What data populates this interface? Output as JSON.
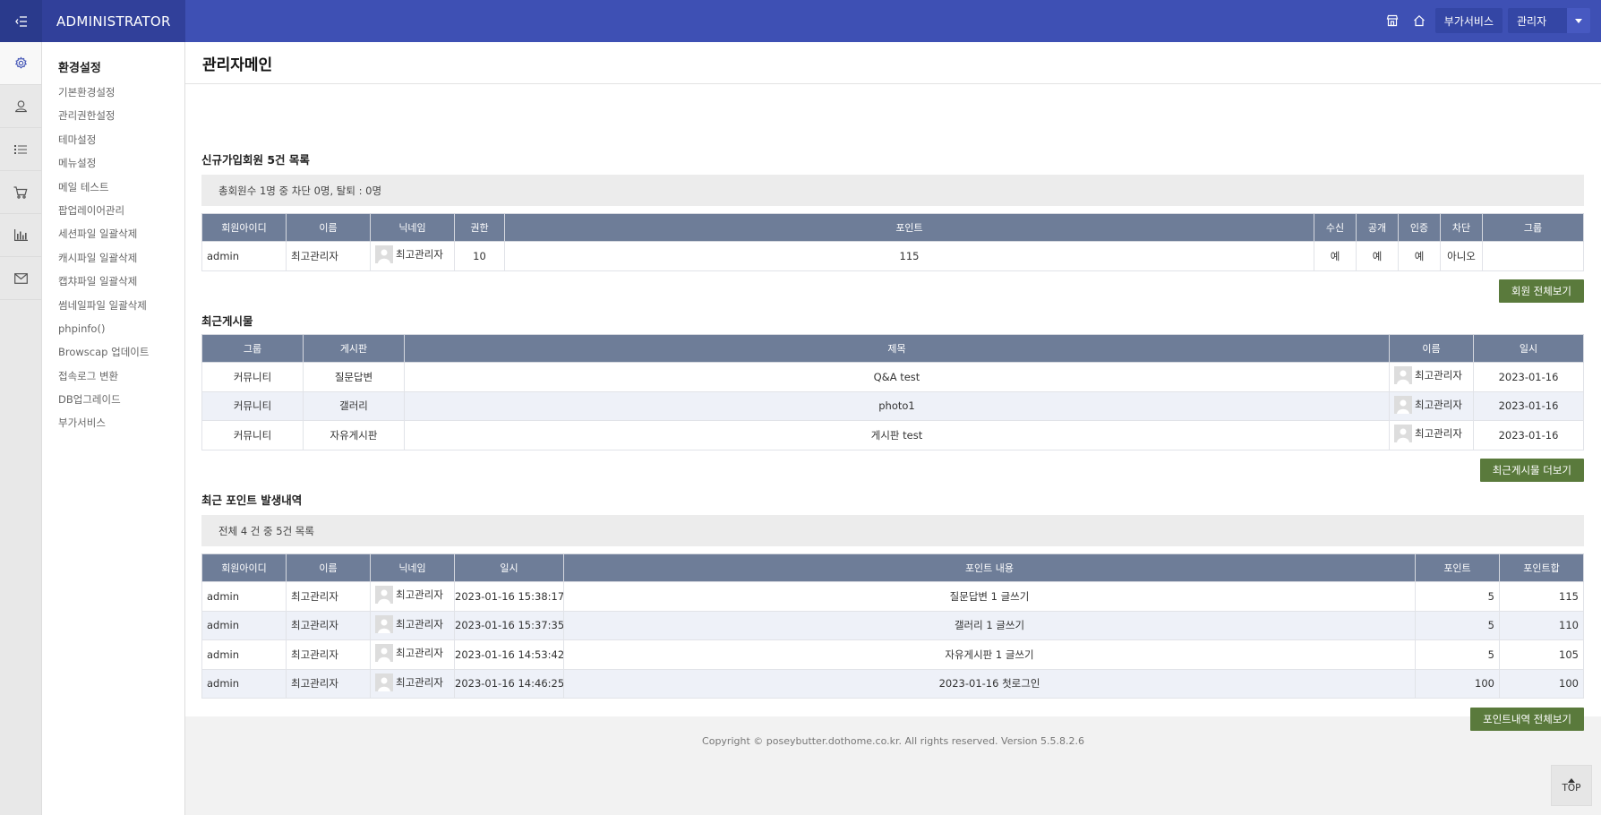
{
  "header": {
    "logo": "ADMINISTRATOR",
    "service_label": "부가서비스",
    "admin_label": "관리자",
    "brand_color": "#3e50b4"
  },
  "rail_icons": [
    "gear-icon",
    "user-icon",
    "list-icon",
    "cart-icon",
    "chart-icon",
    "mail-icon"
  ],
  "submenu": {
    "title": "환경설정",
    "items": [
      "기본환경설정",
      "관리권한설정",
      "테마설정",
      "메뉴설정",
      "메일 테스트",
      "팝업레이어관리",
      "세션파일 일괄삭제",
      "캐시파일 일괄삭제",
      "캡챠파일 일괄삭제",
      "썸네일파일 일괄삭제",
      "phpinfo()",
      "Browscap 업데이트",
      "접속로그 변환",
      "DB업그레이드",
      "부가서비스"
    ]
  },
  "page_title": "관리자메인",
  "new_members": {
    "title": "신규가입회원 5건 목록",
    "summary": "총회원수 1명 중 차단 0명, 탈퇴 : 0명",
    "columns": [
      "회원아이디",
      "이름",
      "닉네임",
      "권한",
      "포인트",
      "수신",
      "공개",
      "인증",
      "차단",
      "그룹"
    ],
    "rows": [
      {
        "id": "admin",
        "name": "최고관리자",
        "nick": "최고관리자",
        "level": "10",
        "point": "115",
        "recv": "예",
        "open": "예",
        "cert": "예",
        "block": "아니오",
        "group": ""
      }
    ],
    "more_label": "회원 전체보기"
  },
  "recent_posts": {
    "title": "최근게시물",
    "columns": [
      "그룹",
      "게시판",
      "제목",
      "이름",
      "일시"
    ],
    "rows": [
      {
        "group": "커뮤니티",
        "board": "질문답변",
        "subject": "Q&A test",
        "name": "최고관리자",
        "date": "2023-01-16"
      },
      {
        "group": "커뮤니티",
        "board": "갤러리",
        "subject": "photo1",
        "name": "최고관리자",
        "date": "2023-01-16"
      },
      {
        "group": "커뮤니티",
        "board": "자유게시판",
        "subject": "게시판 test",
        "name": "최고관리자",
        "date": "2023-01-16"
      }
    ],
    "more_label": "최근게시물 더보기"
  },
  "points": {
    "title": "최근 포인트 발생내역",
    "summary": "전체 4 건 중 5건 목록",
    "columns": [
      "회원아이디",
      "이름",
      "닉네임",
      "일시",
      "포인트 내용",
      "포인트",
      "포인트합"
    ],
    "rows": [
      {
        "id": "admin",
        "name": "최고관리자",
        "nick": "최고관리자",
        "datetime": "2023-01-16 15:38:17",
        "content": "질문답변 1 글쓰기",
        "point": "5",
        "total": "115"
      },
      {
        "id": "admin",
        "name": "최고관리자",
        "nick": "최고관리자",
        "datetime": "2023-01-16 15:37:35",
        "content": "갤러리 1 글쓰기",
        "point": "5",
        "total": "110"
      },
      {
        "id": "admin",
        "name": "최고관리자",
        "nick": "최고관리자",
        "datetime": "2023-01-16 14:53:42",
        "content": "자유게시판 1 글쓰기",
        "point": "5",
        "total": "105"
      },
      {
        "id": "admin",
        "name": "최고관리자",
        "nick": "최고관리자",
        "datetime": "2023-01-16 14:46:25",
        "content": "2023-01-16 첫로그인",
        "point": "100",
        "total": "100"
      }
    ],
    "more_label": "포인트내역 전체보기"
  },
  "footer": "Copyright © poseybutter.dothome.co.kr. All rights reserved. Version 5.5.8.2.6",
  "top_label": "TOP"
}
